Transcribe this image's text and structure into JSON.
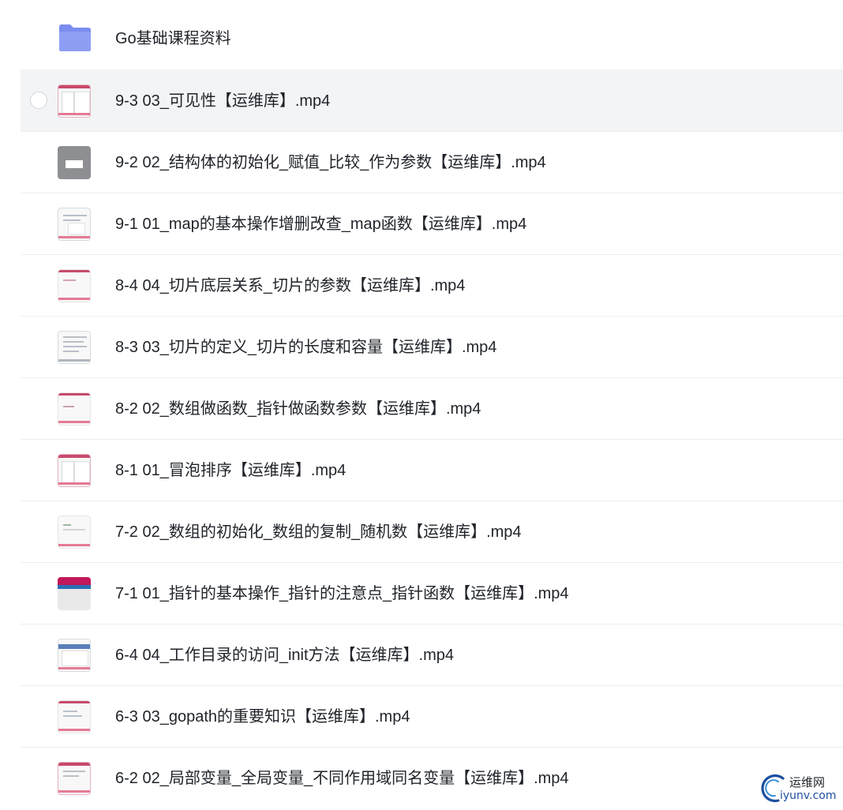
{
  "folder": {
    "name": "Go基础课程资料",
    "icon": "folder-icon",
    "color": "#7b8cf0"
  },
  "files": [
    {
      "name": "9-3 03_可见性【运维库】.mp4",
      "hover": true
    },
    {
      "name": "9-2 02_结构体的初始化_赋值_比较_作为参数【运维库】.mp4"
    },
    {
      "name": "9-1 01_map的基本操作增删改查_map函数【运维库】.mp4"
    },
    {
      "name": "8-4 04_切片底层关系_切片的参数【运维库】.mp4"
    },
    {
      "name": "8-3 03_切片的定义_切片的长度和容量【运维库】.mp4"
    },
    {
      "name": "8-2 02_数组做函数_指针做函数参数【运维库】.mp4"
    },
    {
      "name": "8-1 01_冒泡排序【运维库】.mp4"
    },
    {
      "name": "7-2 02_数组的初始化_数组的复制_随机数【运维库】.mp4"
    },
    {
      "name": "7-1 01_指针的基本操作_指针的注意点_指针函数【运维库】.mp4"
    },
    {
      "name": "6-4 04_工作目录的访问_init方法【运维库】.mp4"
    },
    {
      "name": "6-3 03_gopath的重要知识【运维库】.mp4"
    },
    {
      "name": "6-2 02_局部变量_全局变量_不同作用域同名变量【运维库】.mp4"
    }
  ],
  "watermark": {
    "text_cn": "运维网",
    "text_en": "iyunv.com"
  }
}
